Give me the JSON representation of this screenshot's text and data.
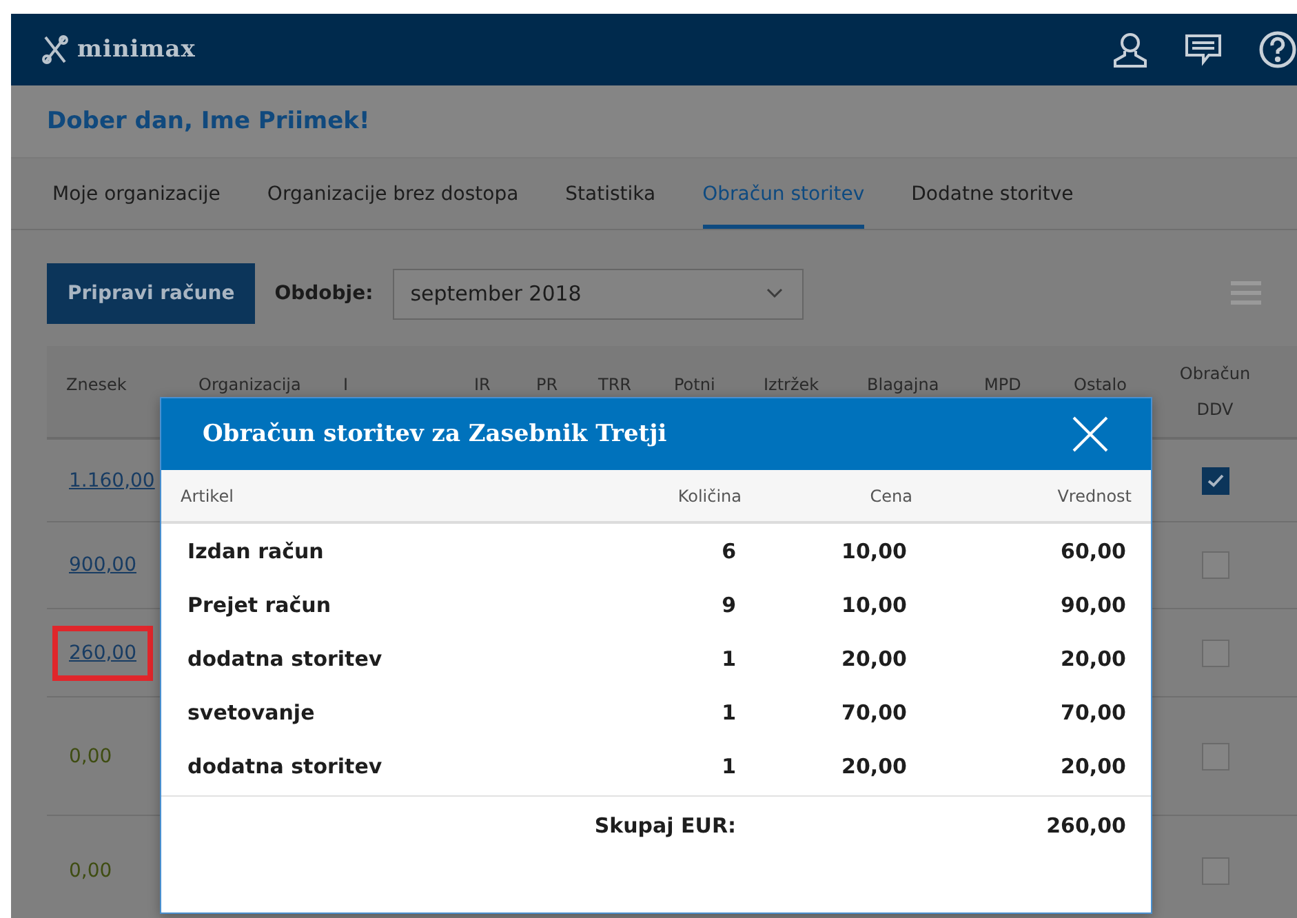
{
  "nav": {
    "logo": "minimax"
  },
  "greeting": "Dober dan, Ime Priimek!",
  "tabs": [
    {
      "label": "Moje organizacije",
      "selected": false
    },
    {
      "label": "Organizacije brez dostopa",
      "selected": false
    },
    {
      "label": "Statistika",
      "selected": false
    },
    {
      "label": "Obračun storitev",
      "selected": true
    },
    {
      "label": "Dodatne storitve",
      "selected": false
    }
  ],
  "toolbar": {
    "button": "Pripravi račune",
    "period_label": "Obdobje:",
    "period_value": "september 2018"
  },
  "table": {
    "columns": [
      "Znesek",
      "Organizacija",
      "I",
      "IR",
      "PR",
      "TRR",
      "Potni",
      "Iztržek",
      "Blagajna",
      "MPD",
      "Ostalo",
      "Obračun DDV"
    ],
    "rows": [
      {
        "amount": "1.160,00",
        "link": true,
        "highlighted": false,
        "ddv_checked": true
      },
      {
        "amount": "900,00",
        "link": true,
        "highlighted": false,
        "ddv_checked": false
      },
      {
        "amount": "260,00",
        "link": true,
        "highlighted": true,
        "ddv_checked": false
      },
      {
        "amount": "0,00",
        "link": false,
        "highlighted": false,
        "ddv_checked": false
      },
      {
        "amount": "0,00",
        "link": false,
        "highlighted": false,
        "ddv_checked": false
      }
    ]
  },
  "dialog": {
    "title": "Obračun storitev za Zasebnik Tretji",
    "columns": [
      "Artikel",
      "Količina",
      "Cena",
      "Vrednost"
    ],
    "rows": [
      [
        "Izdan račun",
        "6",
        "10,00",
        "60,00"
      ],
      [
        "Prejet račun",
        "9",
        "10,00",
        "90,00"
      ],
      [
        "dodatna storitev",
        "1",
        "20,00",
        "20,00"
      ],
      [
        "svetovanje",
        "1",
        "70,00",
        "70,00"
      ],
      [
        "dodatna storitev",
        "1",
        "20,00",
        "20,00"
      ]
    ],
    "total_label": "Skupaj EUR:",
    "total_value": "260,00"
  }
}
